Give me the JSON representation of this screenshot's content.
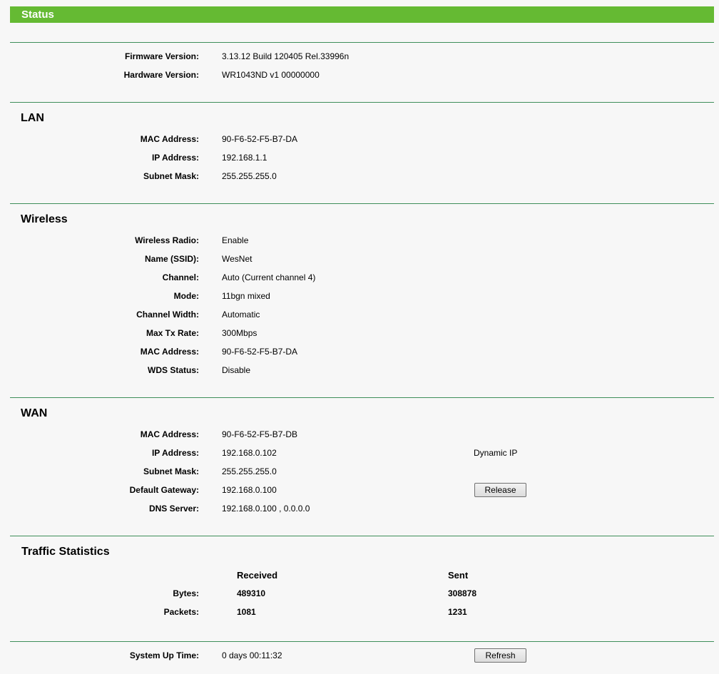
{
  "header": {
    "title": "Status"
  },
  "device": {
    "firmware_label": "Firmware Version:",
    "firmware_value": "3.13.12 Build 120405 Rel.33996n",
    "hardware_label": "Hardware Version:",
    "hardware_value": "WR1043ND v1 00000000"
  },
  "lan": {
    "title": "LAN",
    "mac_label": "MAC Address:",
    "mac_value": "90-F6-52-F5-B7-DA",
    "ip_label": "IP Address:",
    "ip_value": "192.168.1.1",
    "mask_label": "Subnet Mask:",
    "mask_value": "255.255.255.0"
  },
  "wireless": {
    "title": "Wireless",
    "radio_label": "Wireless Radio:",
    "radio_value": "Enable",
    "ssid_label": "Name (SSID):",
    "ssid_value": "WesNet",
    "channel_label": "Channel:",
    "channel_value": "Auto (Current channel 4)",
    "mode_label": "Mode:",
    "mode_value": "11bgn mixed",
    "width_label": "Channel Width:",
    "width_value": "Automatic",
    "rate_label": "Max Tx Rate:",
    "rate_value": "300Mbps",
    "mac_label": "MAC Address:",
    "mac_value": "90-F6-52-F5-B7-DA",
    "wds_label": "WDS Status:",
    "wds_value": "Disable"
  },
  "wan": {
    "title": "WAN",
    "mac_label": "MAC Address:",
    "mac_value": "90-F6-52-F5-B7-DB",
    "ip_label": "IP Address:",
    "ip_value": "192.168.0.102",
    "connection_type": "Dynamic IP",
    "mask_label": "Subnet Mask:",
    "mask_value": "255.255.255.0",
    "gateway_label": "Default Gateway:",
    "gateway_value": "192.168.0.100",
    "release_button": "Release",
    "dns_label": "DNS Server:",
    "dns_value": "192.168.0.100 , 0.0.0.0"
  },
  "traffic": {
    "title": "Traffic Statistics",
    "received_header": "Received",
    "sent_header": "Sent",
    "bytes_label": "Bytes:",
    "bytes_received": "489310",
    "bytes_sent": "308878",
    "packets_label": "Packets:",
    "packets_received": "1081",
    "packets_sent": "1231"
  },
  "uptime": {
    "label": "System Up Time:",
    "value": "0 days 00:11:32",
    "refresh_button": "Refresh"
  },
  "colors": {
    "header_green": "#65ba33",
    "rule_green": "#3e8e5a",
    "background": "#f7f7f7"
  }
}
